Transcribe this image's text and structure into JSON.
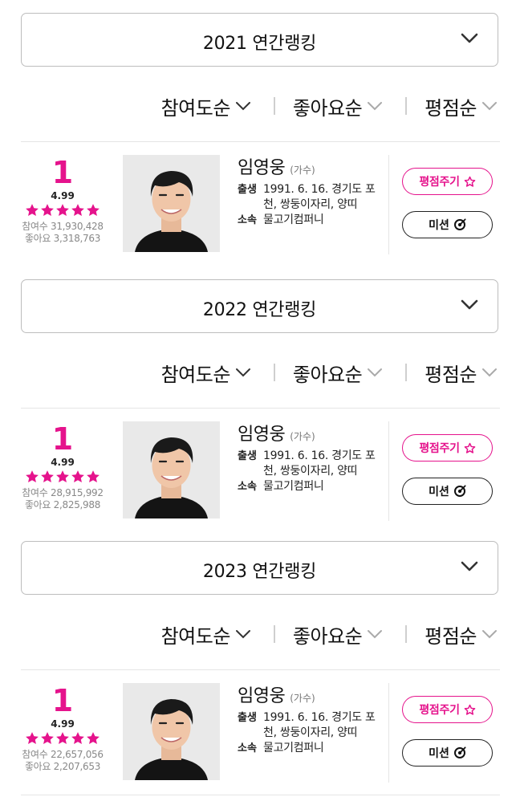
{
  "accent_color": "#e5138c",
  "sort_options": [
    {
      "label": "참여도순",
      "active": true
    },
    {
      "label": "좋아요순",
      "active": false
    },
    {
      "label": "평점순",
      "active": false
    }
  ],
  "sections": [
    {
      "dropdown_title": "2021 연간랭킹",
      "rank": "1",
      "score": "4.99",
      "rating_stars": 5,
      "participants": "참여수 31,930,428",
      "likes": "좋아요 3,318,763",
      "name": "임영웅",
      "job": "(가수)",
      "birth_label": "출생",
      "birth_value": "1991. 6. 16. 경기도 포천, 쌍둥이자리, 양띠",
      "agency_label": "소속",
      "agency_value": "물고기컴퍼니",
      "rate_button": "평점주기",
      "mission_button": "미션"
    },
    {
      "dropdown_title": "2022 연간랭킹",
      "rank": "1",
      "score": "4.99",
      "rating_stars": 5,
      "participants": "참여수 28,915,992",
      "likes": "좋아요 2,825,988",
      "name": "임영웅",
      "job": "(가수)",
      "birth_label": "출생",
      "birth_value": "1991. 6. 16. 경기도 포천, 쌍둥이자리, 양띠",
      "agency_label": "소속",
      "agency_value": "물고기컴퍼니",
      "rate_button": "평점주기",
      "mission_button": "미션"
    },
    {
      "dropdown_title": "2023 연간랭킹",
      "rank": "1",
      "score": "4.99",
      "rating_stars": 5,
      "participants": "참여수 22,657,056",
      "likes": "좋아요 2,207,653",
      "name": "임영웅",
      "job": "(가수)",
      "birth_label": "출생",
      "birth_value": "1991. 6. 16. 경기도 포천, 쌍둥이자리, 양띠",
      "agency_label": "소속",
      "agency_value": "물고기컴퍼니",
      "rate_button": "평점주기",
      "mission_button": "미션"
    }
  ]
}
